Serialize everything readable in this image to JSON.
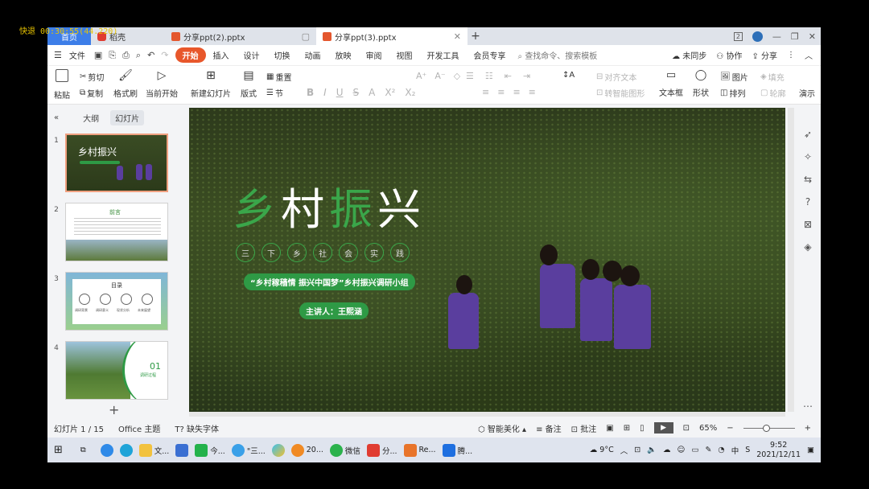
{
  "overlay": {
    "recording_label": "快退 00:30:55(44.220)"
  },
  "tabs": {
    "home": "首页",
    "daoke": "稻壳",
    "files": [
      {
        "name": "分享ppt(2).pptx",
        "active": false
      },
      {
        "name": "分享ppt(3).pptx",
        "active": true
      }
    ]
  },
  "menu": {
    "file": "文件",
    "items": [
      "开始",
      "插入",
      "设计",
      "切换",
      "动画",
      "放映",
      "审阅",
      "视图",
      "开发工具",
      "会员专享"
    ],
    "search_placeholder": "查找命令、搜索模板",
    "right": [
      "未同步",
      "协作",
      "分享"
    ]
  },
  "ribbon": {
    "paste": "粘贴",
    "cut": "剪切",
    "copy": "复制",
    "format_painter": "格式刷",
    "from_current": "当前开始",
    "new_slide": "新建幻灯片",
    "layout": "版式",
    "reset": "重置",
    "section": "节",
    "align_text": "对齐文本",
    "smart_graphic": "转智能图形",
    "textbox": "文本框",
    "shape": "形状",
    "picture": "图片",
    "fill": "填充",
    "arrange": "排列",
    "outline": "轮廓",
    "present": "演示"
  },
  "panel": {
    "tab_outline": "大纲",
    "tab_slides": "幻灯片",
    "slides": [
      {
        "num": "1",
        "title": "乡村振兴"
      },
      {
        "num": "2",
        "title": "前言"
      },
      {
        "num": "3",
        "title": "目录"
      },
      {
        "num": "4",
        "title": "01",
        "subtitle": "调研过程"
      }
    ],
    "slide3_items": [
      "调研背景",
      "调研意义",
      "现状分析",
      "未来展望"
    ]
  },
  "slide": {
    "title_chars": [
      {
        "ch": "乡",
        "green": true
      },
      {
        "ch": "村",
        "green": false
      },
      {
        "ch": "振",
        "green": true
      },
      {
        "ch": "兴",
        "green": false
      }
    ],
    "circles": [
      "三",
      "下",
      "乡",
      "社",
      "会",
      "实",
      "践"
    ],
    "banner": "“乡村稼穑情 振兴中国梦”乡村振兴调研小组",
    "presenter": "主讲人：王熙涵"
  },
  "status": {
    "slide_count": "幻灯片 1 / 15",
    "theme": "Office 主题",
    "missing_font": "缺失字体",
    "beautify": "智能美化",
    "notes": "备注",
    "comments": "批注",
    "zoom": "65%",
    "zoom_fraction": 0.45
  },
  "taskbar": {
    "apps": [
      "文...",
      "今...",
      "\"三...",
      "20...",
      "微信",
      "分...",
      "Re...",
      "腾..."
    ],
    "weather": "9°C",
    "time": "9:52",
    "date": "2021/12/11"
  }
}
